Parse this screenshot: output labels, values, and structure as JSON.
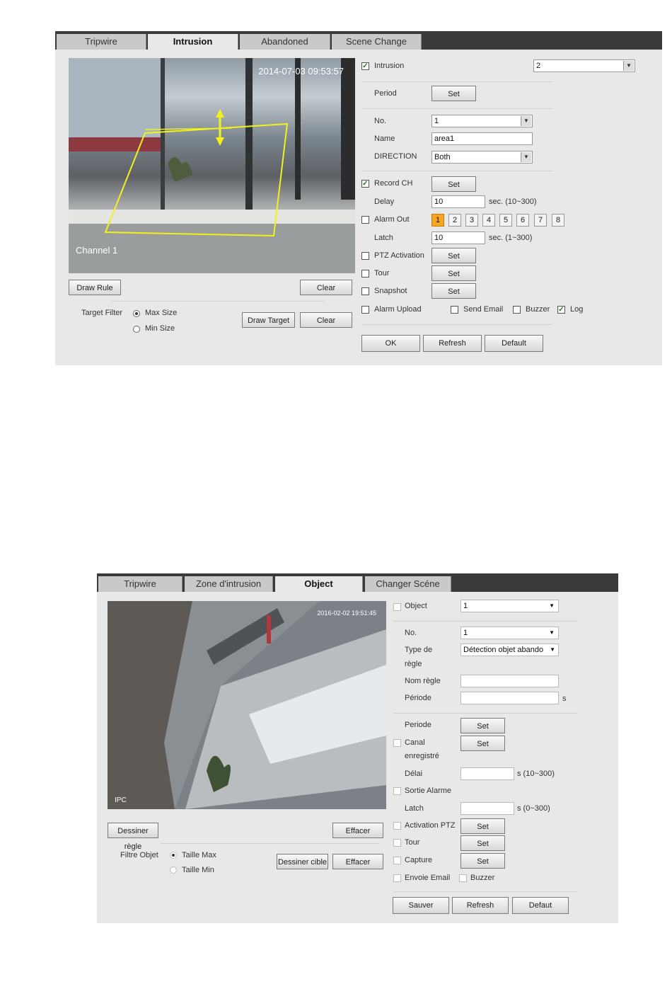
{
  "top": {
    "tabs": [
      "Tripwire",
      "Intrusion",
      "Abandoned",
      "Scene Change"
    ],
    "active_tab": "Intrusion",
    "video": {
      "timestamp": "2014-07-03 09:53:57",
      "channel_label": "Channel 1"
    },
    "draw_rule_label": "Draw Rule",
    "clear_label": "Clear",
    "target_filter_label": "Target Filter",
    "max_size_label": "Max Size",
    "min_size_label": "Min Size",
    "draw_target_label": "Draw Target",
    "clear2_label": "Clear",
    "intrusion_label": "Intrusion",
    "intrusion_value": "2",
    "period_label": "Period",
    "set_label": "Set",
    "no_label": "No.",
    "no_value": "1",
    "name_label": "Name",
    "name_value": "area1",
    "direction_label": "DIRECTION",
    "direction_value": "Both",
    "record_ch_label": "Record CH",
    "delay_label": "Delay",
    "delay_value": "10",
    "delay_unit": "sec. (10~300)",
    "alarm_out_label": "Alarm Out",
    "alarm_channels": [
      "1",
      "2",
      "3",
      "4",
      "5",
      "6",
      "7",
      "8"
    ],
    "latch_label": "Latch",
    "latch_value": "10",
    "latch_unit": "sec. (1~300)",
    "ptz_label": "PTZ Activation",
    "tour_label": "Tour",
    "snapshot_label": "Snapshot",
    "alarm_upload_label": "Alarm Upload",
    "send_email_label": "Send Email",
    "buzzer_label": "Buzzer",
    "log_label": "Log",
    "ok_label": "OK",
    "refresh_label": "Refresh",
    "default_label": "Default"
  },
  "bottom": {
    "tabs": [
      "Tripwire",
      "Zone d'intrusion",
      "Object",
      "Changer Scéne"
    ],
    "active_tab": "Object",
    "video": {
      "timestamp": "2016-02-02 19:51:45",
      "channel_label": "IPC"
    },
    "draw_rule_label": "Dessiner règle",
    "clear_label": "Effacer",
    "filter_label": "Filtre Objet",
    "max_size_label": "Taille Max",
    "min_size_label": "Taille Min",
    "draw_target_label": "Dessiner cible",
    "clear2_label": "Effacer",
    "object_label": "Object",
    "object_value": "1",
    "no_label": "No.",
    "no_value": "1",
    "rule_type_label_1": "Type de",
    "rule_type_label_2": "règle",
    "rule_type_value": "Détection objet abando",
    "rule_name_label": "Nom règle",
    "period_field_label": "Période",
    "period_field_unit": "s",
    "period_label": "Periode",
    "set_label": "Set",
    "record_label_1": "Canal",
    "record_label_2": "enregistré",
    "delay_label": "Délai",
    "delay_unit": "s (10~300)",
    "alarm_out_label": "Sortie Alarme",
    "latch_label": "Latch",
    "latch_unit": "s (0~300)",
    "ptz_label": "Activation PTZ",
    "tour_label": "Tour",
    "capture_label": "Capture",
    "email_label": "Envoie Email",
    "buzzer_label": "Buzzer",
    "save_label": "Sauver",
    "refresh_label": "Refresh",
    "default_label": "Defaut"
  },
  "colors": {
    "accent": "#f5a623",
    "tabbar": "#3a3a3a",
    "panel": "#e8e8e8",
    "rule_line": "#f2f21a"
  }
}
